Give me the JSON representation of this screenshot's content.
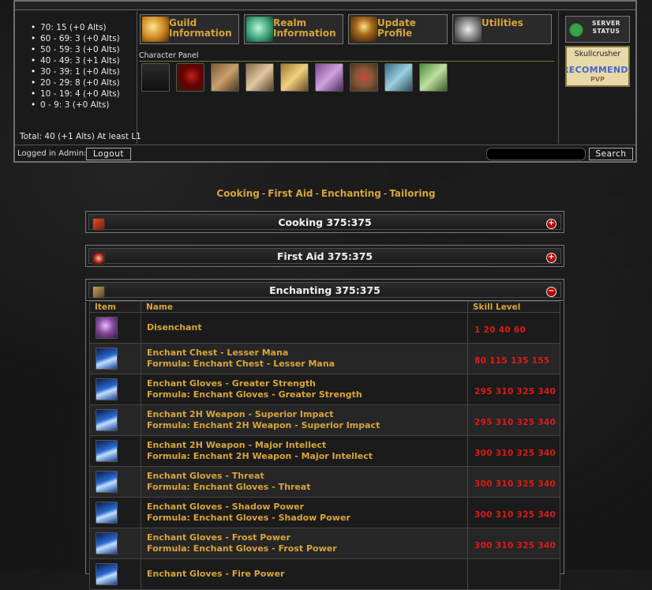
{
  "realm_stats": {
    "levels": [
      "70: 15 (+0 Alts)",
      "60 - 69: 3 (+0 Alts)",
      "50 - 59: 3 (+0 Alts)",
      "40 - 49: 3 (+1 Alts)",
      "30 - 39: 1 (+0 Alts)",
      "20 - 29: 8 (+0 Alts)",
      "10 - 19: 4 (+0 Alts)",
      "0 - 9: 3 (+0 Alts)"
    ],
    "total": "Total: 40 (+1 Alts) At least L1"
  },
  "nav": {
    "guild": "Guild Information",
    "realm": "Realm Information",
    "profile": "Update Profile",
    "utilities": "Utilities"
  },
  "character_panel": {
    "label": "Character Panel",
    "icons": [
      "character-icon",
      "talents-icon",
      "reputation-icon",
      "skills-icon",
      "professions-icon",
      "pets-icon",
      "honor-icon",
      "bank-icon",
      "quests-icon"
    ]
  },
  "sidebar": {
    "server_status": "SERVER STATUS",
    "promo_name": "Skullcrusher",
    "promo_text": "RECOMMENDED",
    "promo_sub": "PVP"
  },
  "admin": {
    "label": "Logged in Admin:",
    "logout": "Logout",
    "search_button": "Search",
    "search_value": ""
  },
  "profession_links": [
    "Cooking",
    "First Aid",
    "Enchanting",
    "Tailoring"
  ],
  "panels": {
    "cooking": {
      "title": "Cooking 375:375",
      "toggle": "+"
    },
    "first_aid": {
      "title": "First Aid 375:375",
      "toggle": "+"
    },
    "enchanting": {
      "title": "Enchanting 375:375",
      "toggle": "−"
    }
  },
  "recipe_table": {
    "headers": {
      "item": "Item",
      "name": "Name",
      "skill": "Skill Level"
    },
    "rows": [
      {
        "name": "Disenchant",
        "formula": "",
        "skill": "1 20 40 60",
        "icon": "disenchant-icon"
      },
      {
        "name": "Enchant Chest - Lesser Mana",
        "formula": "Formula: Enchant Chest - Lesser Mana",
        "skill": "80 115 135 155",
        "icon": "scroll-icon"
      },
      {
        "name": "Enchant Gloves - Greater Strength",
        "formula": "Formula: Enchant Gloves - Greater Strength",
        "skill": "295 310 325 340",
        "icon": "scroll-icon"
      },
      {
        "name": "Enchant 2H Weapon - Superior Impact",
        "formula": "Formula: Enchant 2H Weapon - Superior Impact",
        "skill": "295 310 325 340",
        "icon": "scroll-icon"
      },
      {
        "name": "Enchant 2H Weapon - Major Intellect",
        "formula": "Formula: Enchant 2H Weapon - Major Intellect",
        "skill": "300 310 325 340",
        "icon": "scroll-icon"
      },
      {
        "name": "Enchant Gloves - Threat",
        "formula": "Formula: Enchant Gloves - Threat",
        "skill": "300 310 325 340",
        "icon": "scroll-icon"
      },
      {
        "name": "Enchant Gloves - Shadow Power",
        "formula": "Formula: Enchant Gloves - Shadow Power",
        "skill": "300 310 325 340",
        "icon": "scroll-icon"
      },
      {
        "name": "Enchant Gloves - Frost Power",
        "formula": "Formula: Enchant Gloves - Frost Power",
        "skill": "300 310 325 340",
        "icon": "scroll-icon"
      },
      {
        "name": "Enchant Gloves - Fire Power",
        "formula": "",
        "skill": "",
        "icon": "scroll-icon"
      }
    ]
  }
}
